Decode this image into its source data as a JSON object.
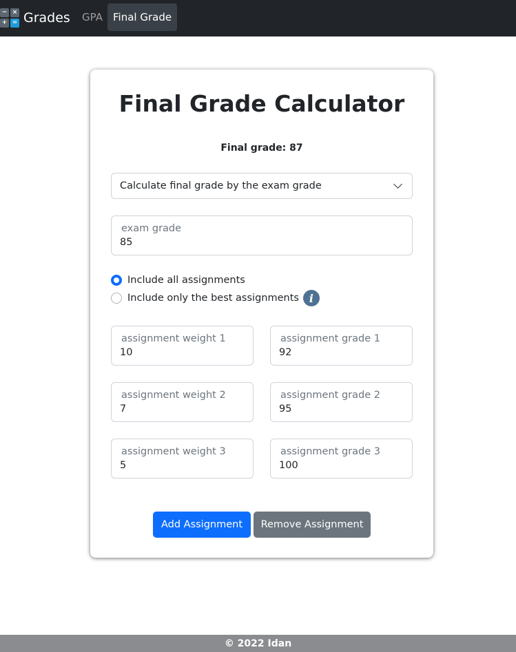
{
  "navbar": {
    "brand": "Grades",
    "logo_keys": [
      "−",
      "×",
      "+",
      "="
    ],
    "links": [
      {
        "label": "GPA",
        "active": false
      },
      {
        "label": "Final Grade",
        "active": true
      }
    ]
  },
  "card": {
    "title": "Final Grade Calculator",
    "final_grade_text": "Final grade: 87",
    "mode_select": {
      "selected": "Calculate final grade by the exam grade"
    },
    "exam": {
      "label": "exam grade",
      "value": "85"
    },
    "radios": [
      {
        "label": "Include all assignments",
        "checked": true
      },
      {
        "label": "Include only the best assignments",
        "checked": false
      }
    ],
    "info_icon": "i",
    "assignments": [
      {
        "weight_label": "assignment weight 1",
        "weight": "10",
        "grade_label": "assignment grade 1",
        "grade": "92"
      },
      {
        "weight_label": "assignment weight 2",
        "weight": "7",
        "grade_label": "assignment grade 2",
        "grade": "95"
      },
      {
        "weight_label": "assignment weight 3",
        "weight": "5",
        "grade_label": "assignment grade 3",
        "grade": "100"
      }
    ],
    "buttons": {
      "add": "Add Assignment",
      "remove": "Remove Assignment"
    }
  },
  "footer": {
    "text": "© 2022 Idan"
  },
  "colors": {
    "navbar_bg": "#212529",
    "primary": "#0d6efd",
    "secondary": "#6c757d",
    "info_icon": "#4f7294",
    "footer_bg": "#8a8c8f"
  }
}
